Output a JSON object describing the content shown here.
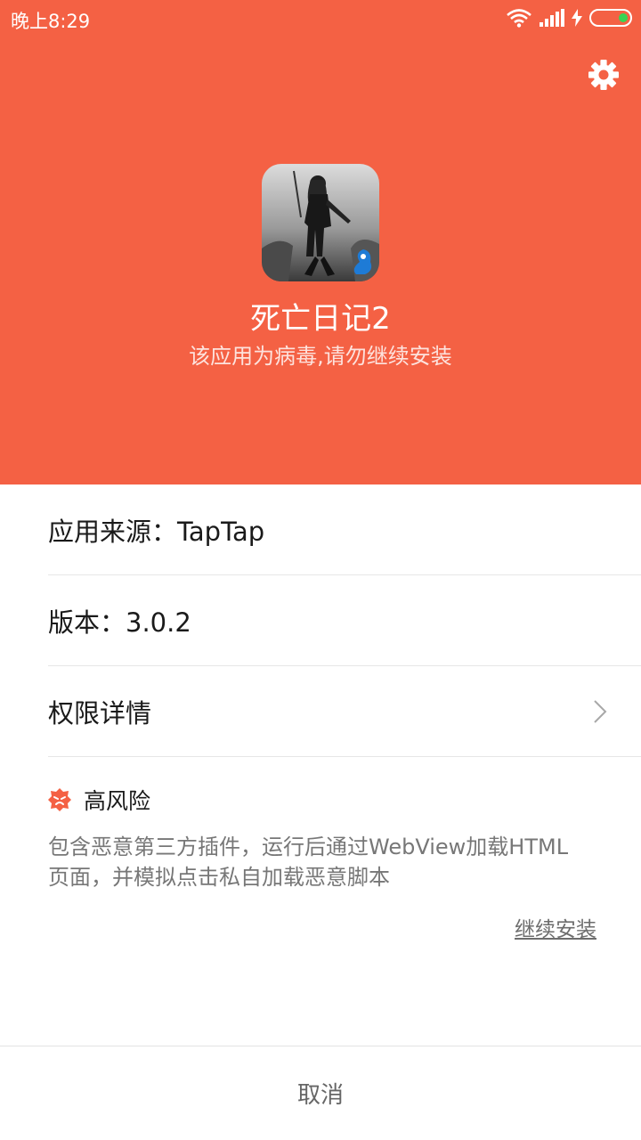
{
  "status_bar": {
    "time": "晚上8:29",
    "battery_color": "#39d353",
    "icons": [
      "wifi-icon",
      "signal-icon",
      "charging-icon",
      "battery-icon"
    ]
  },
  "header": {
    "background": "#f46144",
    "settings_icon": "gear-icon"
  },
  "app": {
    "name": "死亡日记2",
    "warning": "该应用为病毒,请勿继续安装",
    "icon": "game-character-icon"
  },
  "details": {
    "source": "应用来源：TapTap",
    "version": "版本：3.0.2",
    "permissions": "权限详情"
  },
  "risk": {
    "level": "高风险",
    "icon": "danger-icon",
    "color": "#f46144",
    "description": "包含恶意第三方插件，运行后通过WebView加载HTML页面，并模拟点击私自加载恶意脚本"
  },
  "actions": {
    "continue": "继续安装",
    "cancel": "取消"
  }
}
